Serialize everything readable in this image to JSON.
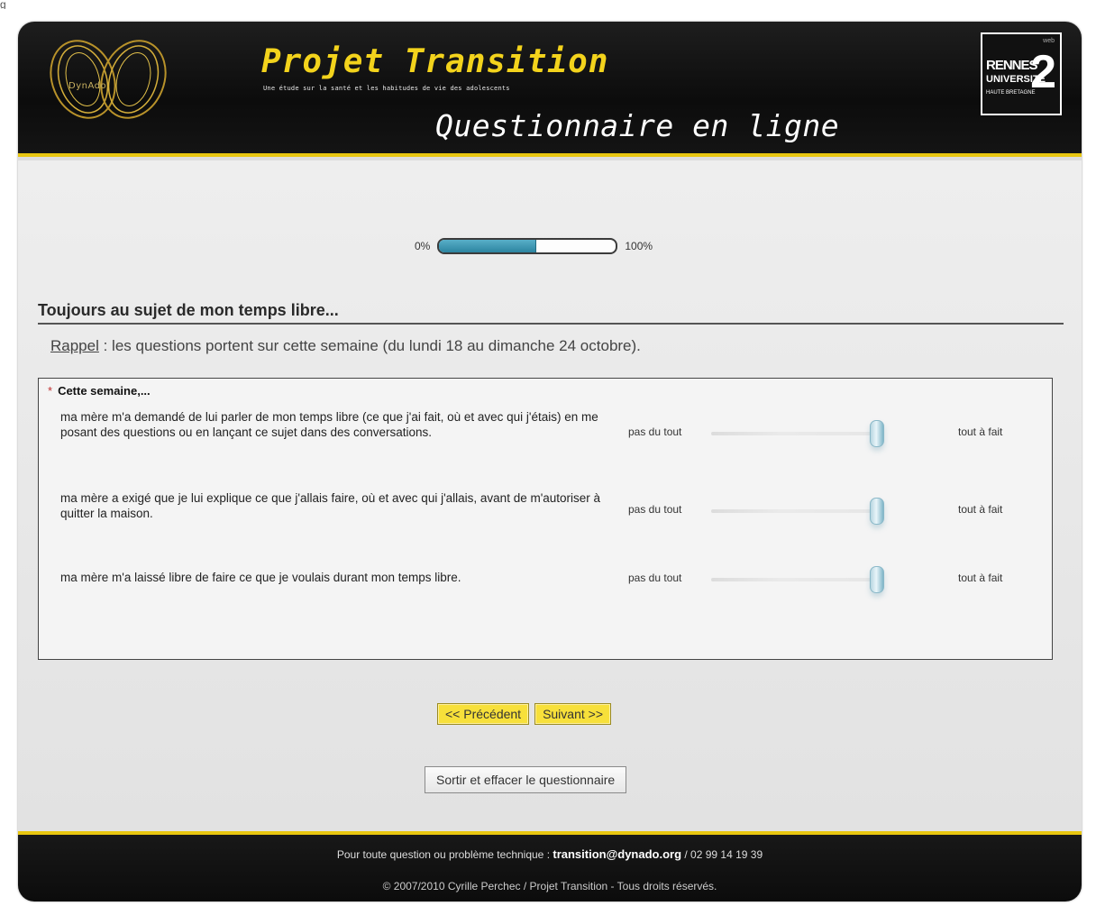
{
  "page_label": "g",
  "header": {
    "logo_left_text": "DynAdo",
    "title": "Projet Transition",
    "subtitle": "Une étude sur la santé et les habitudes de vie des adolescents",
    "page_heading": "Questionnaire en ligne",
    "logo_right": {
      "web": "web",
      "line1": "RENNES",
      "line2": "UNIVERSITÉ",
      "line3": "HAUTE BRETAGNE",
      "number": "2"
    },
    "accent_color": "#e8c610",
    "title_color": "#f3d31c"
  },
  "progress": {
    "min_label": "0%",
    "max_label": "100%",
    "value": 0.55
  },
  "section": {
    "title": "Toujours au sujet de mon temps libre...",
    "reminder_link": "Rappel",
    "reminder_text": " : les questions portent sur cette semaine (du lundi 18 au dimanche 24 octobre)."
  },
  "question": {
    "required_mark": "*",
    "header": "Cette semaine,...",
    "items": [
      {
        "text": "ma mère m'a demandé de lui parler de mon temps libre (ce que j'ai fait, où et avec qui j'étais) en me posant des questions ou en lançant ce sujet dans des conversations.",
        "min_label": "pas du tout",
        "max_label": "tout à fait",
        "value": 1.0
      },
      {
        "text": "ma mère a exigé que je lui explique ce que j'allais faire, où et avec qui j'allais, avant de m'autoriser à quitter la maison.",
        "min_label": "pas du tout",
        "max_label": "tout à fait",
        "value": 1.0
      },
      {
        "text": "ma mère m'a laissé libre de faire ce que je voulais durant mon temps libre.",
        "min_label": "pas du tout",
        "max_label": "tout à fait",
        "value": 1.0
      }
    ]
  },
  "buttons": {
    "previous": "<< Précédent",
    "next": "Suivant >>",
    "exit": "Sortir et effacer le questionnaire"
  },
  "footer": {
    "line1_prefix": "Pour toute question ou problème technique : ",
    "email": "transition@dynado.org",
    "line1_suffix": " / 02 99 14 19 39",
    "line2": "© 2007/2010 Cyrille Perchec / Projet Transition - Tous droits réservés."
  }
}
